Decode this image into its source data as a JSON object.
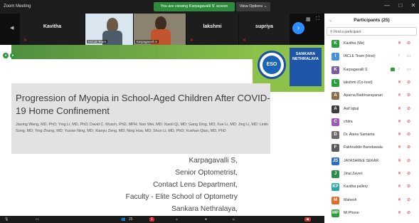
{
  "window": {
    "app_title": "Zoom Meeting",
    "share_banner": "You are viewing Karpagavalli S' screen",
    "view_options": "View Options ⌄",
    "controls": [
      "—",
      "□",
      "✕"
    ]
  },
  "strip": {
    "tiles": [
      {
        "name": "Kavitha",
        "mic": "muted"
      },
      {
        "name": "IACLE Team",
        "video": true
      },
      {
        "name": "Karpagavalli S",
        "video": true
      },
      {
        "name": "lakshmi",
        "mic": "muted"
      },
      {
        "name": "supriya",
        "mic": "muted"
      }
    ],
    "next_icon": "chevron-right-icon"
  },
  "slide": {
    "title": "Progression of Myopia in School-Aged Children After COVID-19 Home Confinement",
    "authors": "Jiaxing Wang, MD, PhD; Ying Li, MD, PhD; David C. Musch, PhD, MPH; Nan Wei, MD; Xiaoli Qi, MD; Gang Ding, MD; Xue Li, MD; Jing Li, MD; Linlin Song, MD; Ying Zhang, MD; Yuxian Ning, MD; Xiaoyu Zeng, MD; Ning Hua, MD; Shuo Li, MD, PhD; Xuehan Qian, MD, PhD",
    "presenter_lines": [
      "Karpagavalli S,",
      "Senior Optometrist,",
      "Contact Lens Department,",
      "Faculty - Elite School of Optometry",
      "Sankara Nethralaya,"
    ],
    "logo_eso": "ESO",
    "logo_sn": "SANKARA NETHRALAYA"
  },
  "toolbar": {
    "participant_count": "25",
    "chat_badge": "1"
  },
  "participants_panel": {
    "title": "Participants (25)",
    "search_placeholder": "Find a participant",
    "list": [
      {
        "name": "Kavitha (Me)",
        "initial": "K",
        "color": "#2d9c3c",
        "mic": "muted",
        "cam": "off"
      },
      {
        "name": "IACLE Team (Host)",
        "initial": "I",
        "color": "#4a90d9",
        "mic": "on",
        "cam": "on"
      },
      {
        "name": "Karpagavalli S",
        "initial": "K",
        "color": "#7a5c9a",
        "mic": "on",
        "cam": "on",
        "sharing": true
      },
      {
        "name": "lakshmi (Co-host)",
        "initial": "L",
        "color": "#2d9c3c",
        "mic": "muted",
        "cam": "off"
      },
      {
        "name": "Aparna Badrinarayanan",
        "initial": "A",
        "color": "#8a6d4e",
        "mic": "muted",
        "cam": "off"
      },
      {
        "name": "Asif Iqbal",
        "initial": "A",
        "color": "#3c3c3c",
        "mic": "muted",
        "cam": "off"
      },
      {
        "name": "chitra",
        "initial": "C",
        "color": "#9b59b6",
        "mic": "muted",
        "cam": "off"
      },
      {
        "name": "Dr. Atanu Samanta",
        "initial": "D",
        "color": "#6b6b6b",
        "mic": "muted",
        "cam": "off"
      },
      {
        "name": "Fakhruddin Barodawala",
        "initial": "F",
        "color": "#5a5a5a",
        "mic": "muted",
        "cam": "off"
      },
      {
        "name": "JAYASHREE SEKAR",
        "initial": "JS",
        "color": "#2d6fc4",
        "mic": "muted",
        "cam": "off"
      },
      {
        "name": "Jinal Zaveri",
        "initial": "J",
        "color": "#2c8c4a",
        "mic": "muted",
        "cam": "off"
      },
      {
        "name": "Kavitha pallery",
        "initial": "KP",
        "color": "#2aa6a6",
        "mic": "muted",
        "cam": "off"
      },
      {
        "name": "Mahesh",
        "initial": "M",
        "color": "#e06a2c",
        "mic": "muted",
        "cam": "off"
      },
      {
        "name": "Mi Phone",
        "initial": "MP",
        "color": "#2d9c3c",
        "mic": "muted",
        "cam": "off"
      }
    ]
  }
}
